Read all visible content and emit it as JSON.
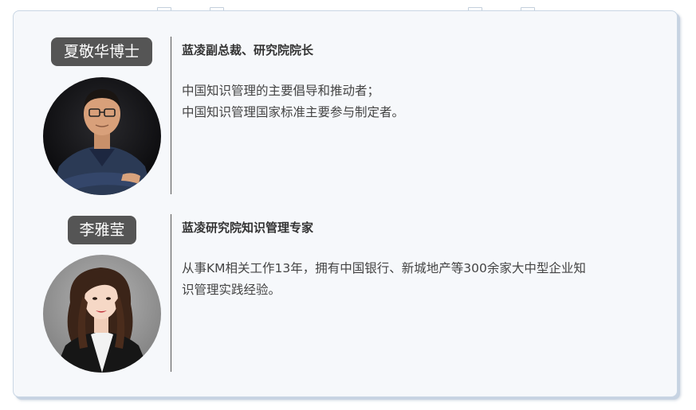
{
  "people": [
    {
      "name": "夏敬华博士",
      "title": "蓝凌副总裁、研究院院长",
      "description_lines": [
        "中国知识管理的主要倡导和推动者；",
        "中国知识管理国家标准主要参与制定者。"
      ]
    },
    {
      "name": "李雅莹",
      "title": "蓝凌研究院知识管理专家",
      "description_lines": [
        "从事KM相关工作13年，拥有中国银行、新城地产等300余家大中型企业知",
        "识管理实践经验。"
      ]
    }
  ],
  "colors": {
    "badge_bg": "#555555",
    "card_bg": "#f6f8fb",
    "card_border": "#c9d6e4",
    "divider": "#555555"
  }
}
